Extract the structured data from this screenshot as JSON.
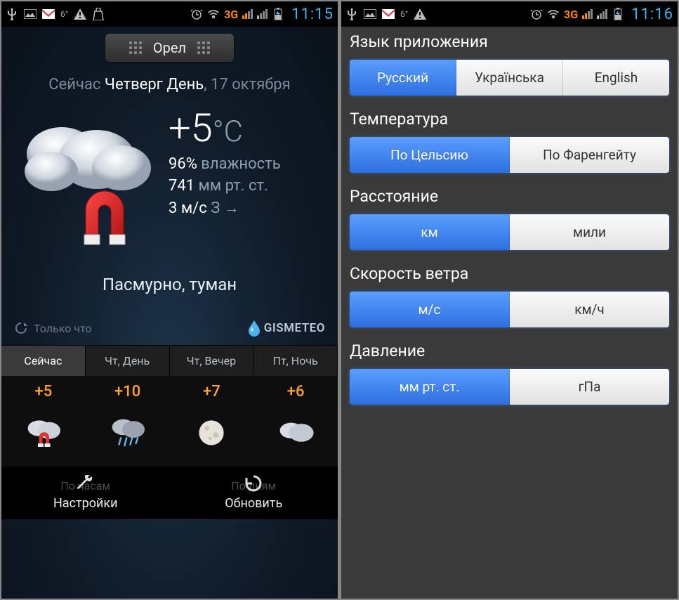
{
  "status": {
    "temp": "6°",
    "threeg": "3G",
    "clock_left": "11:15",
    "clock_right": "11:16"
  },
  "weather": {
    "city": "Орел",
    "now_prefix": "Сейчас",
    "day_label": "Четверг День",
    "date_suffix": ", 17 октября",
    "temperature": "+5",
    "temp_unit": "°C",
    "humidity_value": "96%",
    "humidity_label": " влажность",
    "pressure_value": "741",
    "pressure_label": " мм рт. ст.",
    "wind_value": "3 м/с",
    "wind_dir": " З →",
    "conditions": "Пасмурно, туман",
    "updated": "Только что",
    "brand": "GISMETEO",
    "hidden_btn_left": "По часам",
    "hidden_btn_right": "По дням"
  },
  "forecast": {
    "tabs": [
      "Сейчас",
      "Чт, День",
      "Чт, Вечер",
      "Пт, Ночь"
    ],
    "temps": [
      "+5",
      "+10",
      "+7",
      "+6"
    ]
  },
  "bottom": {
    "settings": "Настройки",
    "refresh": "Обновить"
  },
  "settings": {
    "lang_title": "Язык приложения",
    "lang_options": [
      "Русский",
      "Українська",
      "English"
    ],
    "temp_title": "Температура",
    "temp_options": [
      "По Цельсию",
      "По Фаренгейту"
    ],
    "dist_title": "Расстояние",
    "dist_options": [
      "км",
      "мили"
    ],
    "wind_title": "Скорость ветра",
    "wind_options": [
      "м/с",
      "км/ч"
    ],
    "press_title": "Давление",
    "press_options": [
      "мм рт. ст.",
      "гПа"
    ]
  }
}
